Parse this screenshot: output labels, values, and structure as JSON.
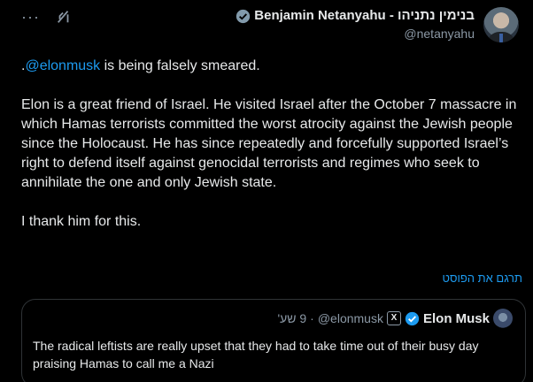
{
  "colors": {
    "background": "#000000",
    "text": "#e7e9ea",
    "muted": "#8b98a5",
    "link": "#1d9bf0",
    "border": "#2f3336"
  },
  "icons": {
    "more": "more-icon",
    "grok": "grok-icon",
    "verified": "verified-icon",
    "affiliate": "x-affiliate-badge"
  },
  "top_actions": {
    "more_label": "···"
  },
  "author": {
    "name": "Benjamin Netanyahu - בנימין נתניהו",
    "handle": "@netanyahu"
  },
  "post": {
    "line1_prefix": ".",
    "mention": "@elonmusk",
    "line1_rest": " is being falsely smeared.",
    "paragraph2": "Elon is a great friend of Israel.  He visited Israel after the October 7 massacre in which Hamas terrorists committed the worst atrocity against the Jewish people since the Holocaust. He has since repeatedly and forcefully supported Israel’s right to defend itself against genocidal terrorists and regimes who seek to annihilate the one and only Jewish state.",
    "paragraph3": "I thank him for this."
  },
  "translate_label": "תרגם את הפוסט",
  "quote": {
    "name": "Elon Musk",
    "affiliate_badge": "X",
    "handle": "@elonmusk",
    "separator": "·",
    "time": "9 שע'",
    "text": "The radical leftists are really upset that they had to take time out of their busy day praising Hamas to call me a Nazi"
  }
}
